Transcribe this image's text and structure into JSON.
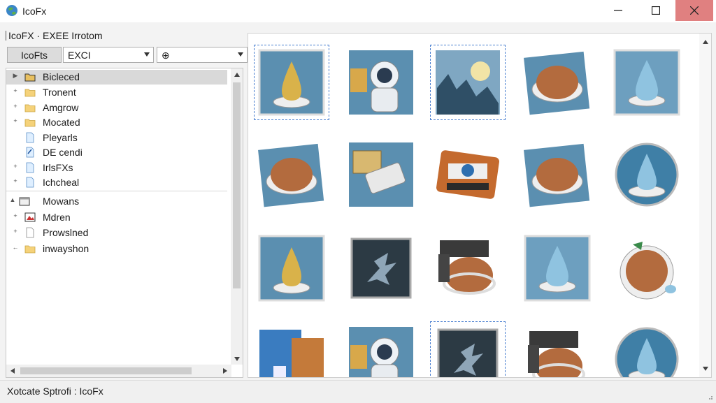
{
  "app": {
    "title": "IcoFx",
    "logo_icon": "globe-icon"
  },
  "window_controls": {
    "minimize_icon": "minimize-icon",
    "maximize_icon": "maximize-icon",
    "close_icon": "close-icon",
    "close_color": "#e08080"
  },
  "breadcrumb": {
    "text": "IcoFX · EXEE Irrotom"
  },
  "toolbar": {
    "button_label": "IcoFts",
    "combo1_value": "EXCI",
    "combo2_icon": "target-icon",
    "combo2_value": "⊕"
  },
  "tree": {
    "items": [
      {
        "label": "Bicleced",
        "icon": "folder-open-icon",
        "expander": "▶",
        "selected": true
      },
      {
        "label": "Tronent",
        "icon": "folder-icon",
        "expander": "+"
      },
      {
        "label": "Amgrow",
        "icon": "folder-icon",
        "expander": "+"
      },
      {
        "label": "Mocated",
        "icon": "folder-icon",
        "expander": "+"
      },
      {
        "label": "Pleyarls",
        "icon": "file-icon",
        "expander": ""
      },
      {
        "label": "DE cendi",
        "icon": "file-check-icon",
        "expander": ""
      },
      {
        "label": "IrlsFXs",
        "icon": "file-icon",
        "expander": "+"
      },
      {
        "label": "Ichcheal",
        "icon": "file-icon",
        "expander": "+"
      },
      {
        "label": "Mowans",
        "icon": "window-icon",
        "expander": "▲"
      },
      {
        "label": "Mdren",
        "icon": "image-icon",
        "expander": "+"
      },
      {
        "label": "Prowslned",
        "icon": "document-icon",
        "expander": "+"
      },
      {
        "label": "inwayshon",
        "icon": "folder-icon",
        "expander": "←"
      }
    ]
  },
  "gallery": {
    "items": [
      {
        "icon": "flame-droplet-icon",
        "selected": true
      },
      {
        "icon": "astronaut-icon"
      },
      {
        "icon": "landscape-picture-icon",
        "selected": true
      },
      {
        "icon": "bread-bowl-icon"
      },
      {
        "icon": "water-drop-icon"
      },
      {
        "icon": "bread-bowl-icon"
      },
      {
        "icon": "usb-drive-icon"
      },
      {
        "icon": "camera-icon"
      },
      {
        "icon": "bread-bowl-icon"
      },
      {
        "icon": "water-drop-round-icon"
      },
      {
        "icon": "flame-droplet-icon"
      },
      {
        "icon": "shatter-icon"
      },
      {
        "icon": "chip-bread-icon"
      },
      {
        "icon": "water-drop-icon"
      },
      {
        "icon": "bread-planet-icon"
      },
      {
        "icon": "book-icon"
      },
      {
        "icon": "astronaut-icon"
      },
      {
        "icon": "shatter-icon",
        "selected": true
      },
      {
        "icon": "chip-bread-icon"
      },
      {
        "icon": "water-drop-round-icon"
      }
    ]
  },
  "status": {
    "text": "Xotcate Sptrofi : IcoFx"
  },
  "colors": {
    "tile_blue": "#5b8fb0",
    "tile_dark": "#2f4f66",
    "bread": "#b36b3e",
    "gold": "#d9b24a",
    "water": "#8fc3e0"
  }
}
